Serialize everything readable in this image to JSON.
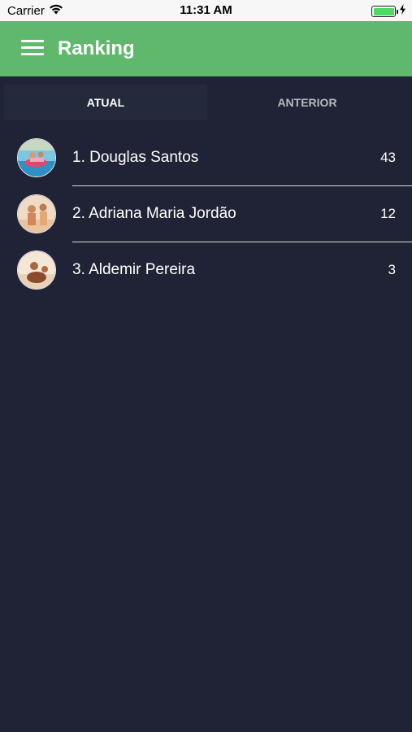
{
  "status_bar": {
    "carrier": "Carrier",
    "time": "11:31 AM"
  },
  "app_bar": {
    "title": "Ranking",
    "menu_icon": "hamburger-menu-icon"
  },
  "tabs": [
    {
      "label": "ATUAL",
      "selected": true
    },
    {
      "label": "ANTERIOR",
      "selected": false
    }
  ],
  "ranking": [
    {
      "name": "1. Douglas Santos",
      "score": "43"
    },
    {
      "name": "2. Adriana Maria Jordão",
      "score": "12"
    },
    {
      "name": "3. Aldemir Pereira",
      "score": "3"
    }
  ],
  "colors": {
    "app_bar": "#5fb86c",
    "background": "#202336",
    "selected_tab": "#242a3c"
  }
}
